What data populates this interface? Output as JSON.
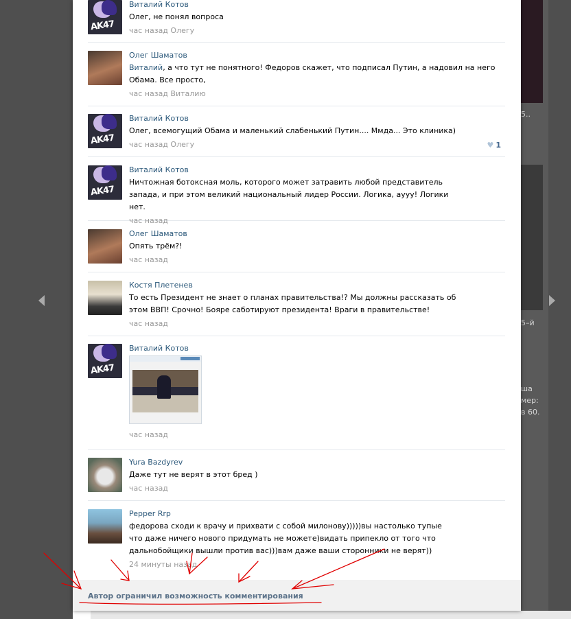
{
  "background": {
    "right_snippets": [
      "5..",
      "5–й",
      "ша",
      "мер:",
      "в 60."
    ]
  },
  "comments": [
    {
      "author": "Виталий Котов",
      "avatar": "pony-avatar",
      "text": "Олег, не понял вопроса",
      "time": "час назад",
      "reply_to": "Олегу"
    },
    {
      "author": "Олег Шаматов",
      "avatar": "photo-avatar",
      "mention": "Виталий",
      "text": ", а что тут не понятного! Федоров скажет, что подписал Путин, а надовил на него Обама. Все просто,",
      "time": "час назад",
      "reply_to": "Виталию"
    },
    {
      "author": "Виталий Котов",
      "avatar": "pony-avatar",
      "text": "Олег, всемогущий Обама и маленький слабенький Путин.... Ммда... Это клиника)",
      "time": "час назад",
      "reply_to": "Олегу",
      "likes": "1"
    },
    {
      "author": "Виталий Котов",
      "avatar": "pony-avatar",
      "text": "Ничтожная ботоксная моль, которого может затравить любой представитель запада, и при этом великий национальный лидер России. Логика, аууу! Логики нет.",
      "time": "час назад"
    },
    {
      "author": "Олег Шаматов",
      "avatar": "photo-avatar",
      "text": "Опять трём?!",
      "time": "час назад"
    },
    {
      "author": "Костя Плетенев",
      "avatar": "photo-avatar",
      "text": "То есть Президент не знает о планах правительства!? Мы должны рассказать об этом ВВП! Срочно! Бояре саботируют президента! Враги в правительстве!",
      "time": "час назад"
    },
    {
      "author": "Виталий Котов",
      "avatar": "pony-avatar",
      "attachment": "photo-attachment",
      "time": "час назад"
    },
    {
      "author": "Yura Bazdyrev",
      "avatar": "photo-avatar",
      "text": "Даже тут не верят в этот бред )",
      "time": "час назад"
    },
    {
      "author": "Pepper Rrp",
      "avatar": "photo-avatar",
      "text": "федорова сходи к врачу и прихвати с собой милонову)))))вы настолько тупые что даже ничего нового придумать не можете)видать припекло от того что дальнобойщики вышли против вас)))вам даже ваши сторонники не верят))",
      "time": "24 минуты назад"
    }
  ],
  "pony_avatar_text": "AK47",
  "footer": {
    "notice": "Автор ограничил возможность комментирования"
  },
  "colors": {
    "link": "#2b587a",
    "meta": "#999999",
    "annotation": "#e00000"
  }
}
